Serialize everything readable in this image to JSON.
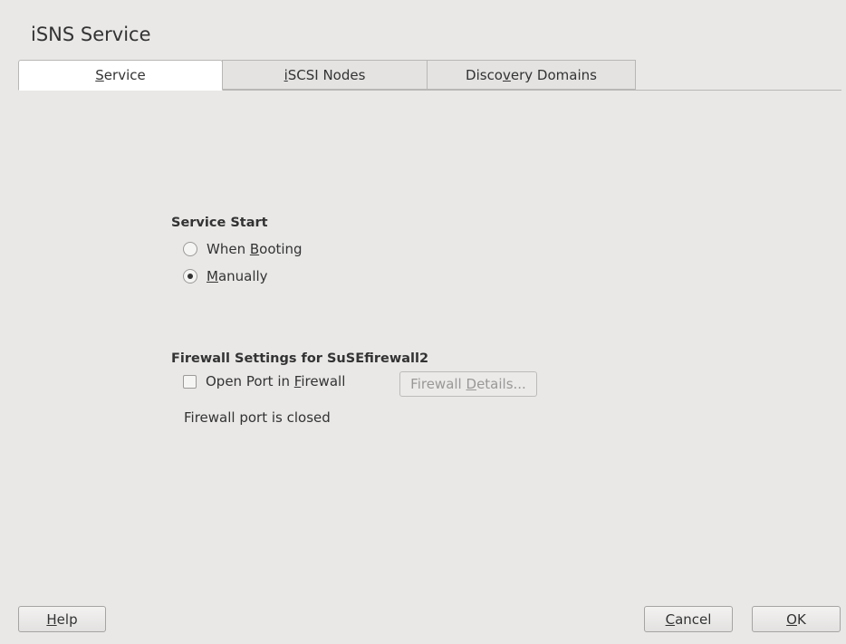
{
  "dialog": {
    "title": "iSNS Service"
  },
  "tabs": [
    {
      "pre": "",
      "key": "S",
      "post": "ervice",
      "active": true
    },
    {
      "pre": "",
      "key": "i",
      "post": "SCSI Nodes",
      "active": false
    },
    {
      "pre": "Disco",
      "key": "v",
      "post": "ery Domains",
      "active": false
    }
  ],
  "service_start": {
    "label": "Service Start",
    "options": [
      {
        "pre": "When ",
        "key": "B",
        "post": "ooting",
        "selected": false
      },
      {
        "pre": "",
        "key": "M",
        "post": "anually",
        "selected": true
      }
    ]
  },
  "firewall": {
    "label": "Firewall Settings for SuSEfirewall2",
    "open_port": {
      "pre": "Open Port in ",
      "key": "F",
      "post": "irewall",
      "checked": false
    },
    "details_button": {
      "pre": "Firewall ",
      "key": "D",
      "post": "etails..."
    },
    "status": "Firewall port is closed"
  },
  "footer": {
    "help": {
      "pre": "",
      "key": "H",
      "post": "elp"
    },
    "cancel": {
      "pre": "",
      "key": "C",
      "post": "ancel"
    },
    "ok": {
      "pre": "",
      "key": "O",
      "post": "K"
    }
  }
}
